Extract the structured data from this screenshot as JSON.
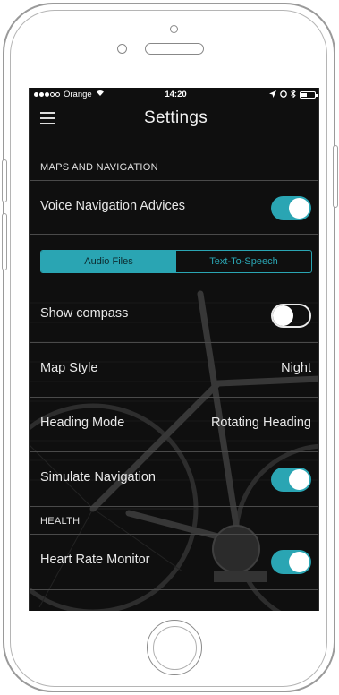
{
  "status_bar": {
    "carrier": "Orange",
    "time": "14:20"
  },
  "header": {
    "title": "Settings",
    "menu_icon": "hamburger-menu-icon"
  },
  "sections": {
    "maps": {
      "header": "MAPS AND NAVIGATION",
      "voice_navigation": {
        "label": "Voice Navigation Advices",
        "enabled": true
      },
      "audio_mode": {
        "options": [
          "Audio Files",
          "Text-To-Speech"
        ],
        "selected": "Audio Files"
      },
      "show_compass": {
        "label": "Show compass",
        "enabled": false
      },
      "map_style": {
        "label": "Map Style",
        "value": "Night"
      },
      "heading_mode": {
        "label": "Heading Mode",
        "value": "Rotating Heading"
      },
      "simulate_navigation": {
        "label": "Simulate Navigation",
        "enabled": true
      }
    },
    "health": {
      "header": "HEALTH",
      "heart_rate_monitor": {
        "label": "Heart Rate Monitor",
        "enabled": true
      }
    }
  },
  "colors": {
    "accent": "#2aa5b3",
    "background": "#141414",
    "divider": "#4a4a4a"
  }
}
